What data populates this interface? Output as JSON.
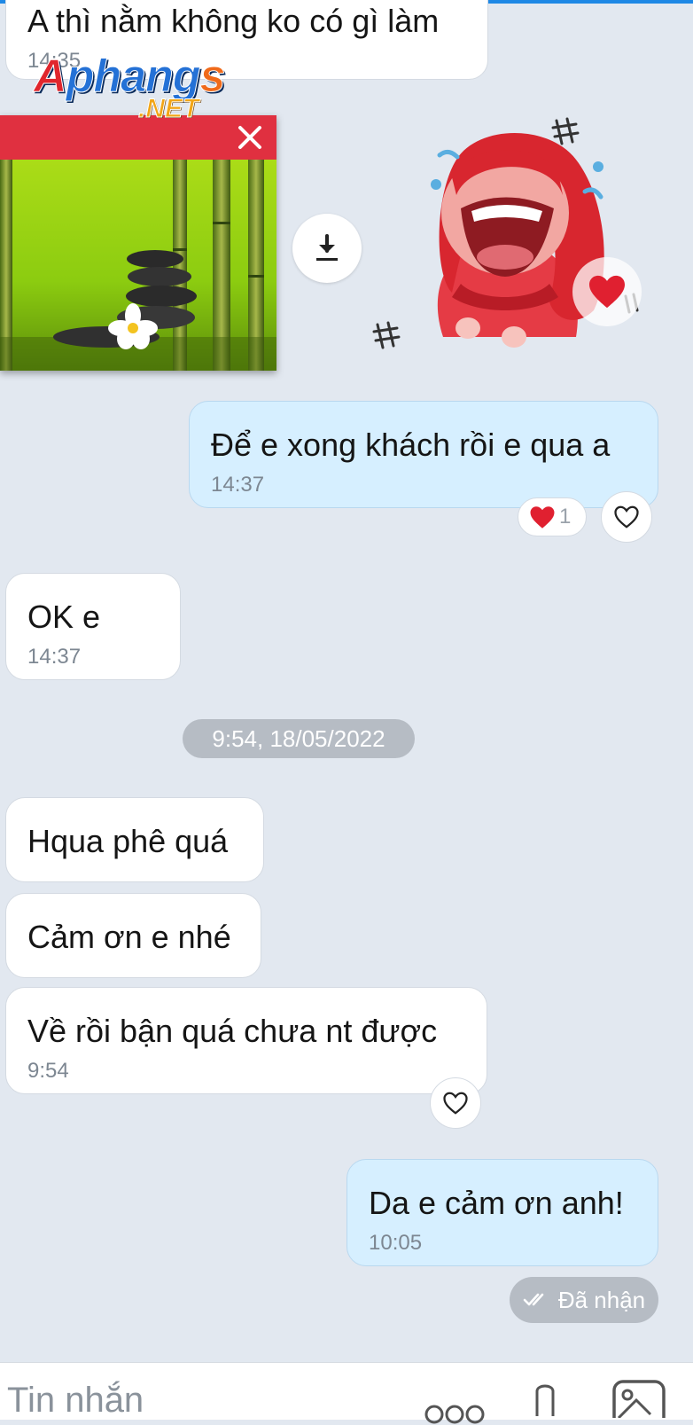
{
  "logo": {
    "main": "Aphangs",
    "main_first": "A",
    "main_mid": "phang",
    "main_last": "s",
    "sub": ".NET"
  },
  "messages": {
    "m0": {
      "text": "A thì nằm không ko có gì làm",
      "time": "14:35"
    },
    "m1": {
      "text": "Để e xong khách rồi e qua a",
      "time": "14:37",
      "reaction_count": "1"
    },
    "m2": {
      "text": "OK e",
      "time": "14:37"
    },
    "m3": {
      "text": "Hqua phê quá"
    },
    "m4": {
      "text": "Cảm ơn e nhé"
    },
    "m5": {
      "text": "Về rồi bận quá chưa nt được",
      "time": "9:54"
    },
    "m6": {
      "text": "Da e cảm ơn anh!",
      "time": "10:05"
    }
  },
  "date_separator": "9:54, 18/05/2022",
  "status": {
    "label": "Đã nhận",
    "icon": "double-check-icon"
  },
  "input": {
    "placeholder": "Tin nhắn"
  },
  "icons": [
    "close-icon",
    "download-icon",
    "heart-icon",
    "heart-outline-icon",
    "double-check-icon",
    "more-icon",
    "attach-icon",
    "image-icon"
  ],
  "colors": {
    "background": "#e2e8f0",
    "my_bubble": "#d6efff",
    "their_bubble": "#ffffff",
    "accent": "#1e88e5",
    "heart": "#e02030",
    "ad_header": "#e03040",
    "pill": "#b6bcc4"
  }
}
